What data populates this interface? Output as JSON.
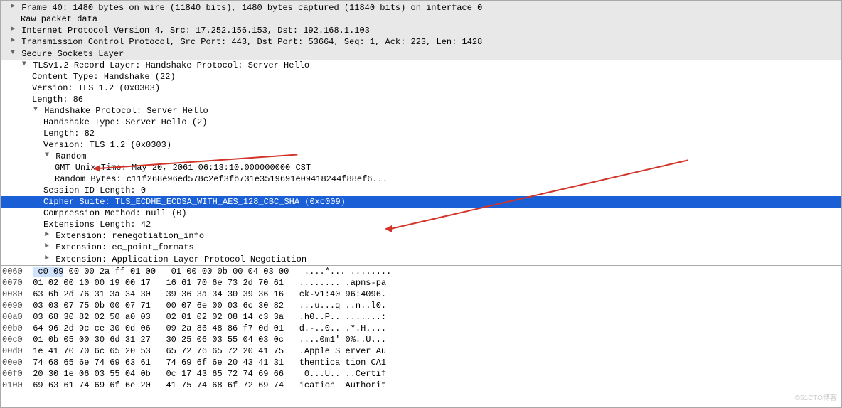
{
  "tree": {
    "frame": "Frame 40: 1480 bytes on wire (11840 bits), 1480 bytes captured (11840 bits) on interface 0",
    "raw": "Raw packet data",
    "ipv4": "Internet Protocol Version 4, Src: 17.252.156.153, Dst: 192.168.1.103",
    "tcp": "Transmission Control Protocol, Src Port: 443, Dst Port: 53664, Seq: 1, Ack: 223, Len: 1428",
    "ssl": "Secure Sockets Layer",
    "tls_record": "TLSv1.2 Record Layer: Handshake Protocol: Server Hello",
    "content_type": "Content Type: Handshake (22)",
    "rec_version": "Version: TLS 1.2 (0x0303)",
    "rec_length": "Length: 86",
    "handshake_proto": "Handshake Protocol: Server Hello",
    "handshake_type": "Handshake Type: Server Hello (2)",
    "hs_length": "Length: 82",
    "hs_version": "Version: TLS 1.2 (0x0303)",
    "random": "Random",
    "gmt": "GMT Unix Time: May 20, 2061 06:13:10.000000000 CST",
    "rand_bytes": "Random Bytes: c11f268e96ed578c2ef3fb731e3519691e09418244f88ef6...",
    "session_id_len": "Session ID Length: 0",
    "cipher_suite": "Cipher Suite: TLS_ECDHE_ECDSA_WITH_AES_128_CBC_SHA (0xc009)",
    "compression": "Compression Method: null (0)",
    "ext_length": "Extensions Length: 42",
    "ext_reneg": "Extension: renegotiation_info",
    "ext_ecpoint": "Extension: ec_point_formats",
    "ext_alpn": "Extension: Application Layer Protocol Negotiation"
  },
  "hex": [
    {
      "offset": "0060",
      "b1_hl": " c0 09",
      "b1": " 00 00 2a ff 01 00",
      "b2": "01 00 00 0b 00 04 03 00",
      "a1": "....*... ........"
    },
    {
      "offset": "0070",
      "b1": "01 02 00 10 00 19 00 17",
      "b2": "16 61 70 6e 73 2d 70 61",
      "a1": "........ .apns-pa"
    },
    {
      "offset": "0080",
      "b1": "63 6b 2d 76 31 3a 34 30",
      "b2": "39 36 3a 34 30 39 36 16",
      "a1": "ck-v1:40 96:4096."
    },
    {
      "offset": "0090",
      "b1": "03 03 07 75 0b 00 07 71",
      "b2": "00 07 6e 00 03 6c 30 82",
      "a1": "...u...q ..n..l0."
    },
    {
      "offset": "00a0",
      "b1": "03 68 30 82 02 50 a0 03",
      "b2": "02 01 02 02 08 14 c3 3a",
      "a1": ".h0..P.. .......:"
    },
    {
      "offset": "00b0",
      "b1": "64 96 2d 9c ce 30 0d 06",
      "b2": "09 2a 86 48 86 f7 0d 01",
      "a1": "d.-..0.. .*.H...."
    },
    {
      "offset": "00c0",
      "b1": "01 0b 05 00 30 6d 31 27",
      "b2": "30 25 06 03 55 04 03 0c",
      "a1": "....0m1' 0%..U..."
    },
    {
      "offset": "00d0",
      "b1": "1e 41 70 70 6c 65 20 53",
      "b2": "65 72 76 65 72 20 41 75",
      "a1": ".Apple S erver Au"
    },
    {
      "offset": "00e0",
      "b1": "74 68 65 6e 74 69 63 61",
      "b2": "74 69 6f 6e 20 43 41 31",
      "a1": "thentica tion CA1"
    },
    {
      "offset": "00f0",
      "b1": "20 30 1e 06 03 55 04 0b",
      "b2": "0c 17 43 65 72 74 69 66",
      "a1": " 0...U.. ..Certif"
    },
    {
      "offset": "0100",
      "b1": "69 63 61 74 69 6f 6e 20",
      "b2": "41 75 74 68 6f 72 69 74",
      "a1": "ication  Authorit"
    }
  ],
  "watermark": "©51CTO博客"
}
